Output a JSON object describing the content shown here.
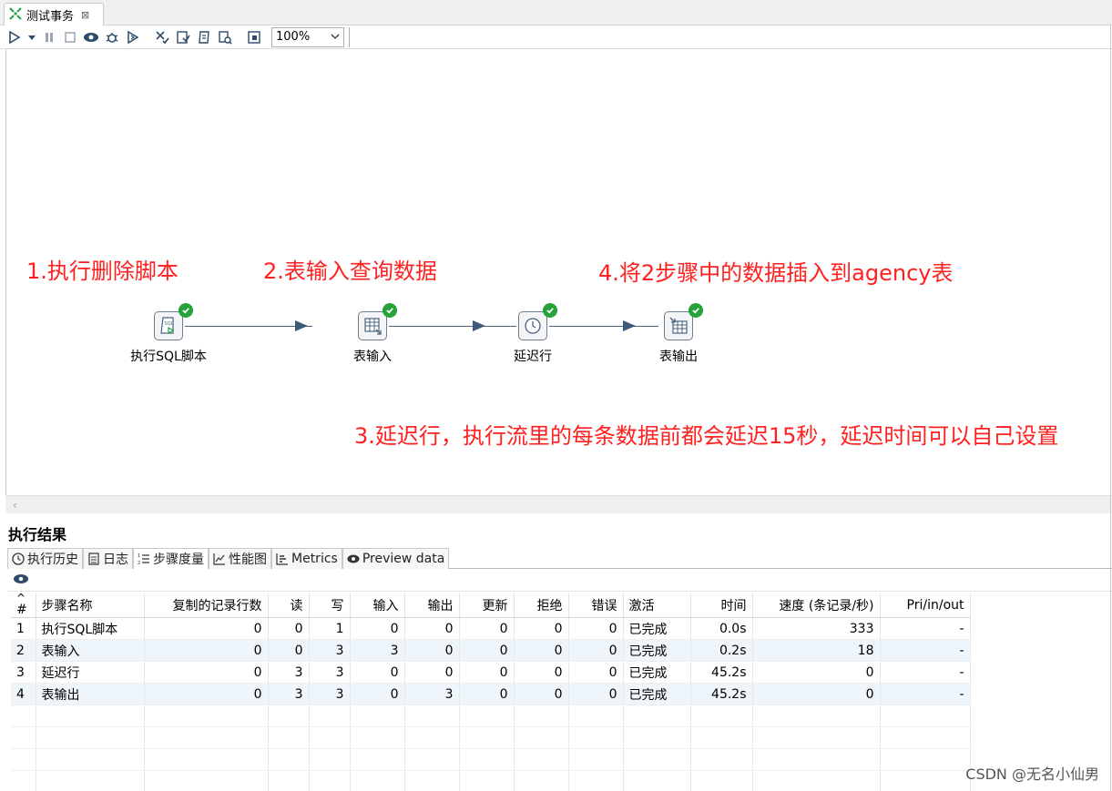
{
  "tab": {
    "title": "测试事务",
    "close": "⊠"
  },
  "toolbar": {
    "zoom": "100%"
  },
  "annotations": {
    "a1": "1.执行删除脚本",
    "a2": "2.表输入查询数据",
    "a3": "3.延迟行，执行流里的每条数据前都会延迟15秒，延迟时间可以自己设置",
    "a4": "4.将2步骤中的数据插入到agency表"
  },
  "steps": [
    {
      "label": "执行SQL脚本",
      "status": "success"
    },
    {
      "label": "表输入",
      "status": "success"
    },
    {
      "label": "延迟行",
      "status": "success"
    },
    {
      "label": "表输出",
      "status": "success"
    }
  ],
  "results": {
    "title": "执行结果",
    "tabs": [
      "执行历史",
      "日志",
      "步骤度量",
      "性能图",
      "Metrics",
      "Preview data"
    ],
    "active_tab": "步骤度量",
    "columns": [
      "#",
      "步骤名称",
      "复制的记录行数",
      "读",
      "写",
      "输入",
      "输出",
      "更新",
      "拒绝",
      "错误",
      "激活",
      "时间",
      "速度 (条记录/秒)",
      "Pri/in/out"
    ],
    "rows": [
      [
        "1",
        "执行SQL脚本",
        "0",
        "0",
        "1",
        "0",
        "0",
        "0",
        "0",
        "0",
        "已完成",
        "0.0s",
        "333",
        "-"
      ],
      [
        "2",
        "表输入",
        "0",
        "0",
        "3",
        "3",
        "0",
        "0",
        "0",
        "0",
        "已完成",
        "0.2s",
        "18",
        "-"
      ],
      [
        "3",
        "延迟行",
        "0",
        "3",
        "3",
        "0",
        "0",
        "0",
        "0",
        "0",
        "已完成",
        "45.2s",
        "0",
        "-"
      ],
      [
        "4",
        "表输出",
        "0",
        "3",
        "3",
        "0",
        "3",
        "0",
        "0",
        "0",
        "已完成",
        "45.2s",
        "0",
        "-"
      ]
    ]
  },
  "watermark": "CSDN @无名小仙男",
  "colors": {
    "annotation": "#ff2020",
    "success": "#25a23a",
    "row_alt": "#eef5fb"
  }
}
